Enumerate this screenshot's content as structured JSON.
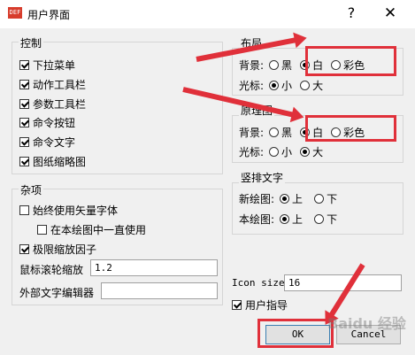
{
  "window": {
    "title": "用户界面",
    "icon_label": "DEF",
    "help_label": "?",
    "close_label": "✕"
  },
  "control": {
    "title": "控制",
    "items": [
      {
        "label": "下拉菜单",
        "checked": true
      },
      {
        "label": "动作工具栏",
        "checked": true
      },
      {
        "label": "参数工具栏",
        "checked": true
      },
      {
        "label": "命令按钮",
        "checked": true
      },
      {
        "label": "命令文字",
        "checked": true
      },
      {
        "label": "图纸缩略图",
        "checked": true
      }
    ]
  },
  "misc": {
    "title": "杂项",
    "always_vector_font": "始终使用矢量字体",
    "always_in_drawing": "在本绘图中一直使用",
    "limit_zoom": "极限缩放因子",
    "wheel_zoom_label": "鼠标滚轮缩放",
    "wheel_zoom_value": "1.2",
    "external_editor_label": "外部文字编辑器",
    "external_editor_value": ""
  },
  "layout": {
    "title": "布局",
    "background_label": "背景:",
    "bg_options": [
      "黑",
      "白",
      "彩色"
    ],
    "bg_selected": "白",
    "cursor_label": "光标:",
    "cursor_options": [
      "小",
      "大"
    ],
    "cursor_selected": "小"
  },
  "model": {
    "title": "原理图",
    "background_label": "背景:",
    "bg_options": [
      "黑",
      "白",
      "彩色"
    ],
    "bg_selected": "白",
    "cursor_label": "光标:",
    "cursor_options": [
      "小",
      "大"
    ],
    "cursor_selected": "大"
  },
  "vertical_text": {
    "title": "竖排文字",
    "new_drawing_label": "新绘图:",
    "this_drawing_label": "本绘图:",
    "options": [
      "上",
      "下"
    ],
    "new_selected": "上",
    "this_selected": "上"
  },
  "icon_size": {
    "label": "Icon size",
    "value": "16"
  },
  "user_guide": {
    "label": "用户指导",
    "checked": true
  },
  "buttons": {
    "ok": "OK",
    "cancel": "Cancel"
  },
  "annotation_color": "#e0303a",
  "watermark": "Baidu 经验"
}
